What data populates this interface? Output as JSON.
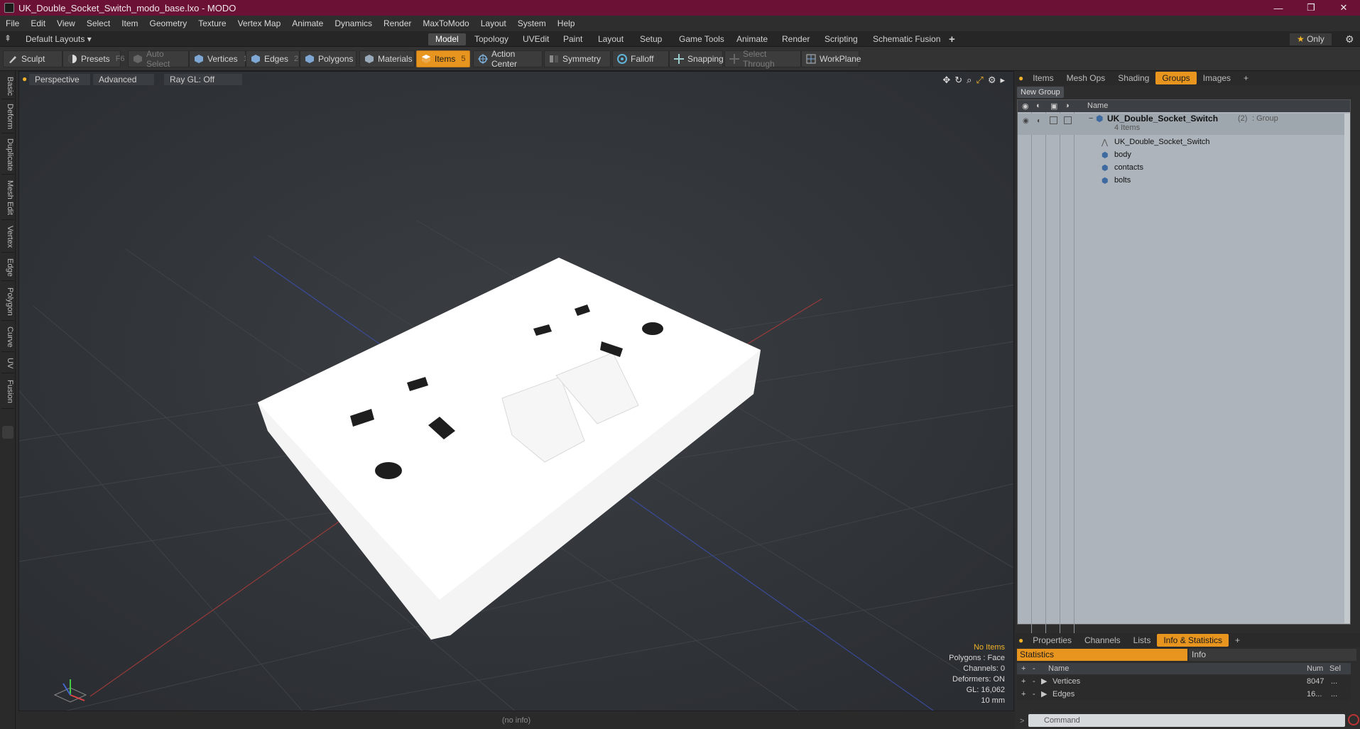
{
  "window": {
    "title": "UK_Double_Socket_Switch_modo_base.lxo - MODO",
    "controls": [
      "—",
      "❐",
      "✕"
    ]
  },
  "menu": [
    "File",
    "Edit",
    "View",
    "Select",
    "Item",
    "Geometry",
    "Texture",
    "Vertex Map",
    "Animate",
    "Dynamics",
    "Render",
    "MaxToModo",
    "Layout",
    "System",
    "Help"
  ],
  "layout_bar": {
    "default_layouts": "Default Layouts ▾",
    "tabs": [
      "Model",
      "Topology",
      "UVEdit",
      "Paint",
      "Layout",
      "Setup",
      "Game Tools",
      "Animate",
      "Render",
      "Scripting",
      "Schematic Fusion"
    ],
    "active_tab": "Model",
    "add": "+",
    "only": "Only"
  },
  "toolbar": {
    "sculpt": "Sculpt",
    "presets": "Presets",
    "presets_key": "F6",
    "auto_select": "Auto Select",
    "vertices": "Vertices",
    "vertices_key": "1",
    "edges": "Edges",
    "edges_key": "2",
    "polygons": "Polygons",
    "materials": "Materials",
    "items": "Items",
    "items_key": "5",
    "action_center": "Action Center",
    "symmetry": "Symmetry",
    "falloff": "Falloff",
    "snapping": "Snapping",
    "select_through": "Select Through",
    "workplane": "WorkPlane"
  },
  "left_tabs": [
    "Basic",
    "Deform",
    "Duplicate",
    "Mesh Edit",
    "Vertex",
    "Edge",
    "Polygon",
    "Curve",
    "UV",
    "Fusion"
  ],
  "viewport": {
    "view": "Perspective",
    "shading": "Advanced",
    "raygl": "Ray GL: Off",
    "info": {
      "items": "No Items",
      "polygons": "Polygons : Face",
      "channels": "Channels: 0",
      "deformers": "Deformers: ON",
      "gl": "GL: 16,062",
      "unit": "10 mm"
    }
  },
  "statusbar": "(no info)",
  "right_panel": {
    "tabs": [
      "Items",
      "Mesh Ops",
      "Shading",
      "Groups",
      "Images"
    ],
    "active_tab": "Groups",
    "new_group": "New Group",
    "list_header": "Name",
    "group": {
      "name": "UK_Double_Socket_Switch",
      "count": "(2)",
      "type": ": Group",
      "sub": "4 Items"
    },
    "children": [
      "UK_Double_Socket_Switch",
      "body",
      "contacts",
      "bolts"
    ],
    "bottom_tabs": [
      "Properties",
      "Channels",
      "Lists",
      "Info & Statistics"
    ],
    "bottom_active": "Info & Statistics",
    "stats": {
      "tab_statistics": "Statistics",
      "tab_info": "Info",
      "col_name": "Name",
      "col_num": "Num",
      "col_sel": "Sel",
      "rows": [
        {
          "name": "Vertices",
          "num": "8047",
          "sel": "..."
        },
        {
          "name": "Edges",
          "num": "16...",
          "sel": "..."
        }
      ]
    },
    "command_placeholder": "Command"
  }
}
